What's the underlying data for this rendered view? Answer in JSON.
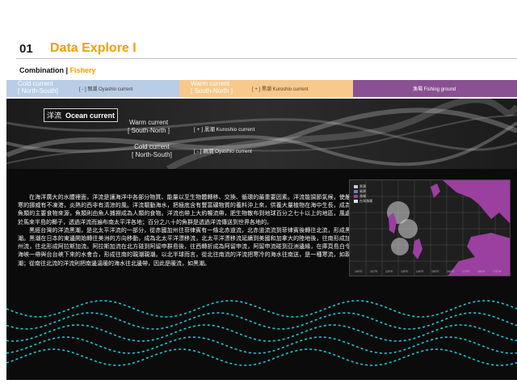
{
  "header": {
    "page_number": "01",
    "title": "Data Explore I",
    "subtitle_main": "Combination",
    "subtitle_sep": " | ",
    "subtitle_accent": "Fishery"
  },
  "legend_bar": {
    "cold": {
      "main": "Cold current\n[ North-South]",
      "tag": "[ - ] 親潮  Oyashio current"
    },
    "warm": {
      "main": "Warm current\n[ South-North ]",
      "tag": "[ + ] 黒潮  Kuroshio current"
    },
    "fish": {
      "main": "",
      "tag": "漁場  Fishing ground"
    }
  },
  "wave_panel": {
    "ocean_label_cn": "洋流",
    "ocean_label_en": "Ocean current",
    "warm_label": "Warm current\n[ South-North ]",
    "warm_key": "[ + ] 黒潮  Kuroshio current",
    "cold_label": "Cold current\n[ North-South]",
    "cold_key": "[ - ] 親潮  Oyashio current"
  },
  "body": {
    "p1": "在海洋廣大的水體裡面，洋流是讓海洋中各部分物質、能量以至生物體轉移、交換、循環的最重要因素。洋流能調節氣候，使嚴寒的挪威有不凍港，炎熱的西非有清涼的風。洋流驅動海水，把極底含有豐富礦物質的養料沖上來，供養大量植物在海中生長，成為魚類的主要食物來源，魚類則由魚人捕撈成為人類的食物。洋流也帶上大約暢流帶，肥生物散布到地球百分之七十以上的地區，風處於馬來半島的椰子，透過洋流而遍布南太平洋各地；百分之八十的魚群是透過洋流傳送到世界各地的。",
    "p2": "黑經台灣的洋流黑潮，是北太平洋流的一部分，從赤國加州往菲律賓有一條北赤道流，北赤道流流到菲律賓後轉往北流，形成黑潮。黑潮在日本的東邊開始轉往美洲的方向移動，成為北太平洋漂移流，北太平洋漂移流延續到美國和加拿大的陸地後，往南形成加州流，往北形成阿拉斯加流。阿拉斯加流在北方碰到阿留申群島後，往西轉折成為阿留申流，阿留申流碰到亞洲邊緣，在庫頁島白令海峽一帶與台台峽下來的水會合，形成往南的親潮親潮。以北半球而言，從北往南流的洋流把寒冷的海水往南送，是一種寒流，如親潮；從南往北流的洋流則把南邊溫暖的海水往北邊帶，因此是暖流，如黑潮。"
  },
  "map": {
    "legend": [
      "黒潮",
      "親潮",
      "漁場",
      "台灣漁場"
    ],
    "colors": {
      "land": "#9b3fa0",
      "kuroshio": "#c9c9c9",
      "oyashio": "#6a7fb0",
      "grid": "#555555"
    },
    "lon_ticks": [
      "100°E",
      "110°E",
      "120°E",
      "130°E",
      "140°E",
      "150°E",
      "160°E",
      "170°E",
      "180°E",
      "170°W"
    ]
  },
  "colors": {
    "accent": "#f0a000",
    "cold": "#b9cde6",
    "warm": "#f7c98b",
    "fishing": "#8a5192",
    "wave_cyan": "#1ec8d8",
    "panel_dark": "#0b0b0b"
  }
}
